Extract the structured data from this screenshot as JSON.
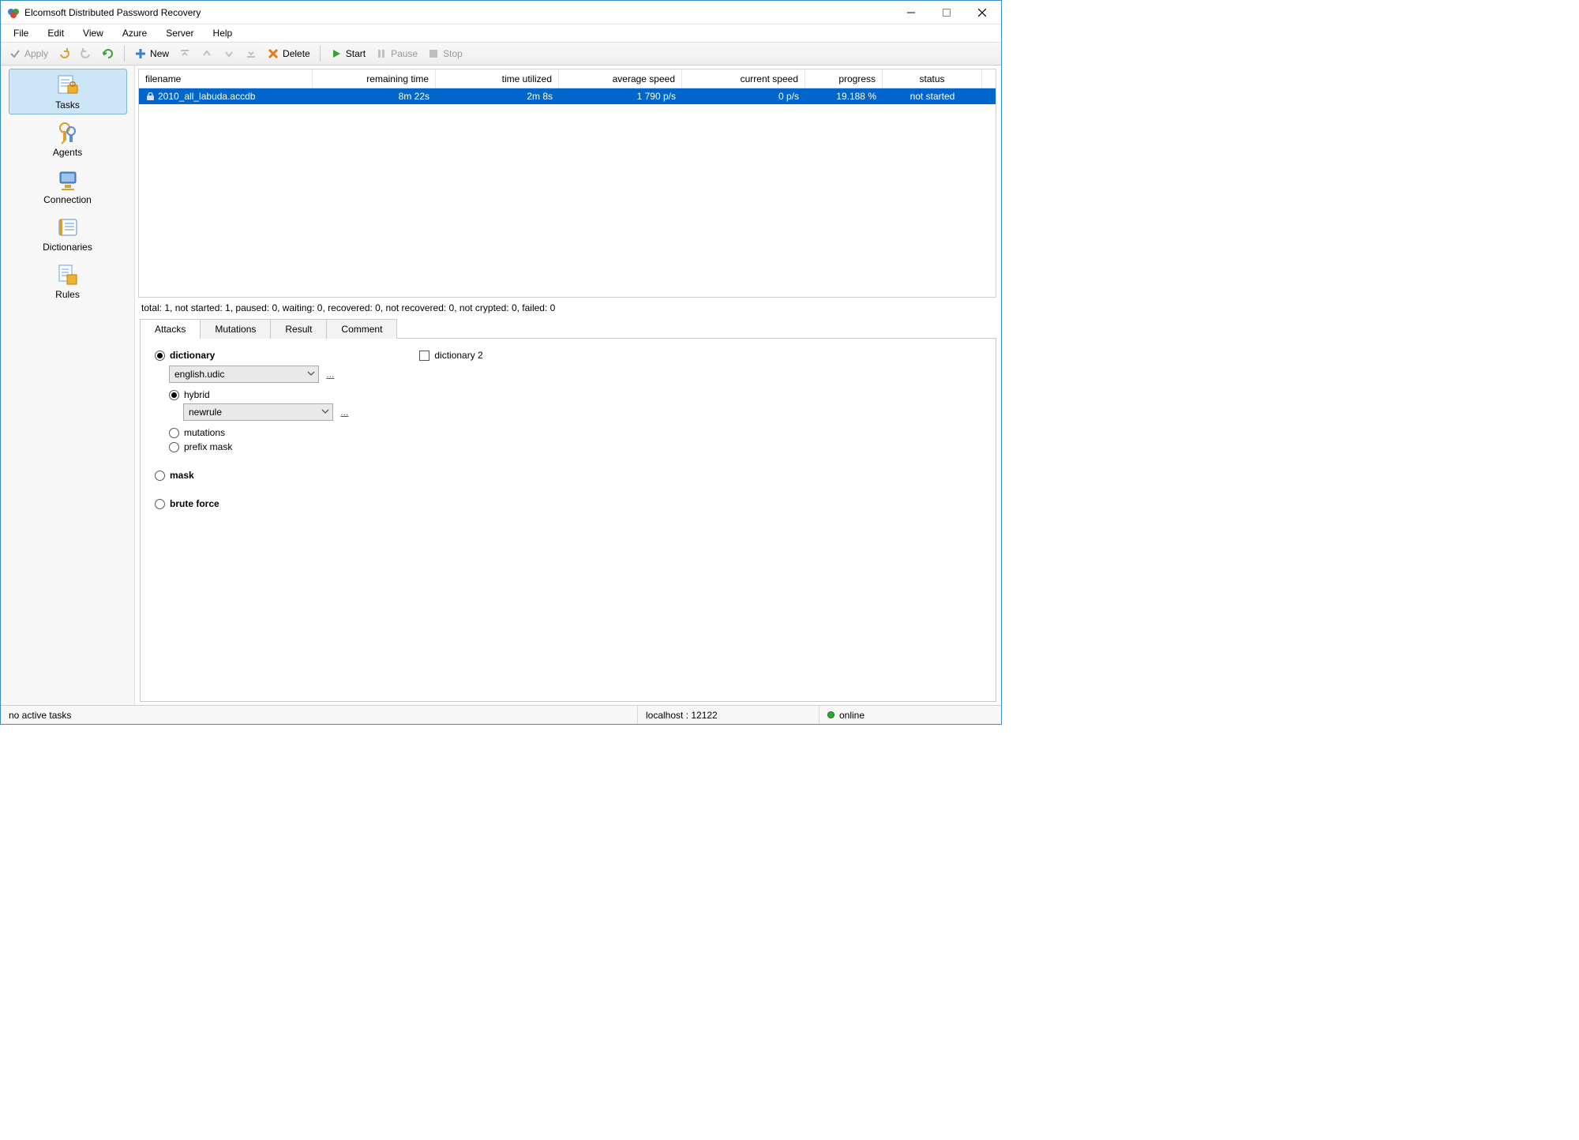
{
  "window": {
    "title": "Elcomsoft Distributed Password Recovery"
  },
  "menu": {
    "file": "File",
    "edit": "Edit",
    "view": "View",
    "azure": "Azure",
    "server": "Server",
    "help": "Help"
  },
  "toolbar": {
    "apply": "Apply",
    "new": "New",
    "delete": "Delete",
    "start": "Start",
    "pause": "Pause",
    "stop": "Stop"
  },
  "sidebar": {
    "tasks": "Tasks",
    "agents": "Agents",
    "connection": "Connection",
    "dictionaries": "Dictionaries",
    "rules": "Rules"
  },
  "table": {
    "headers": {
      "filename": "filename",
      "remaining": "remaining time",
      "utilized": "time utilized",
      "avgspeed": "average speed",
      "curspeed": "current speed",
      "progress": "progress",
      "status": "status"
    },
    "row": {
      "filename": "2010_all_labuda.accdb",
      "remaining": "8m 22s",
      "utilized": "2m 8s",
      "avgspeed": "1 790  p/s",
      "curspeed": "0  p/s",
      "progress": "19.188 %",
      "status": "not started"
    }
  },
  "summary": "total: 1,   not started: 1,   paused: 0,   waiting: 0,   recovered: 0,   not recovered: 0,   not crypted: 0,   failed: 0",
  "tabs": {
    "attacks": "Attacks",
    "mutations": "Mutations",
    "result": "Result",
    "comment": "Comment"
  },
  "attacks": {
    "dictionary": "dictionary",
    "dictionary2": "dictionary 2",
    "dict_file": "english.udic",
    "hybrid": "hybrid",
    "hybrid_rule": "newrule",
    "mutations": "mutations",
    "prefix_mask": "prefix mask",
    "mask": "mask",
    "brute_force": "brute force",
    "dots": "..."
  },
  "status": {
    "left": "no active tasks",
    "host": "localhost : 12122",
    "online": "online"
  }
}
